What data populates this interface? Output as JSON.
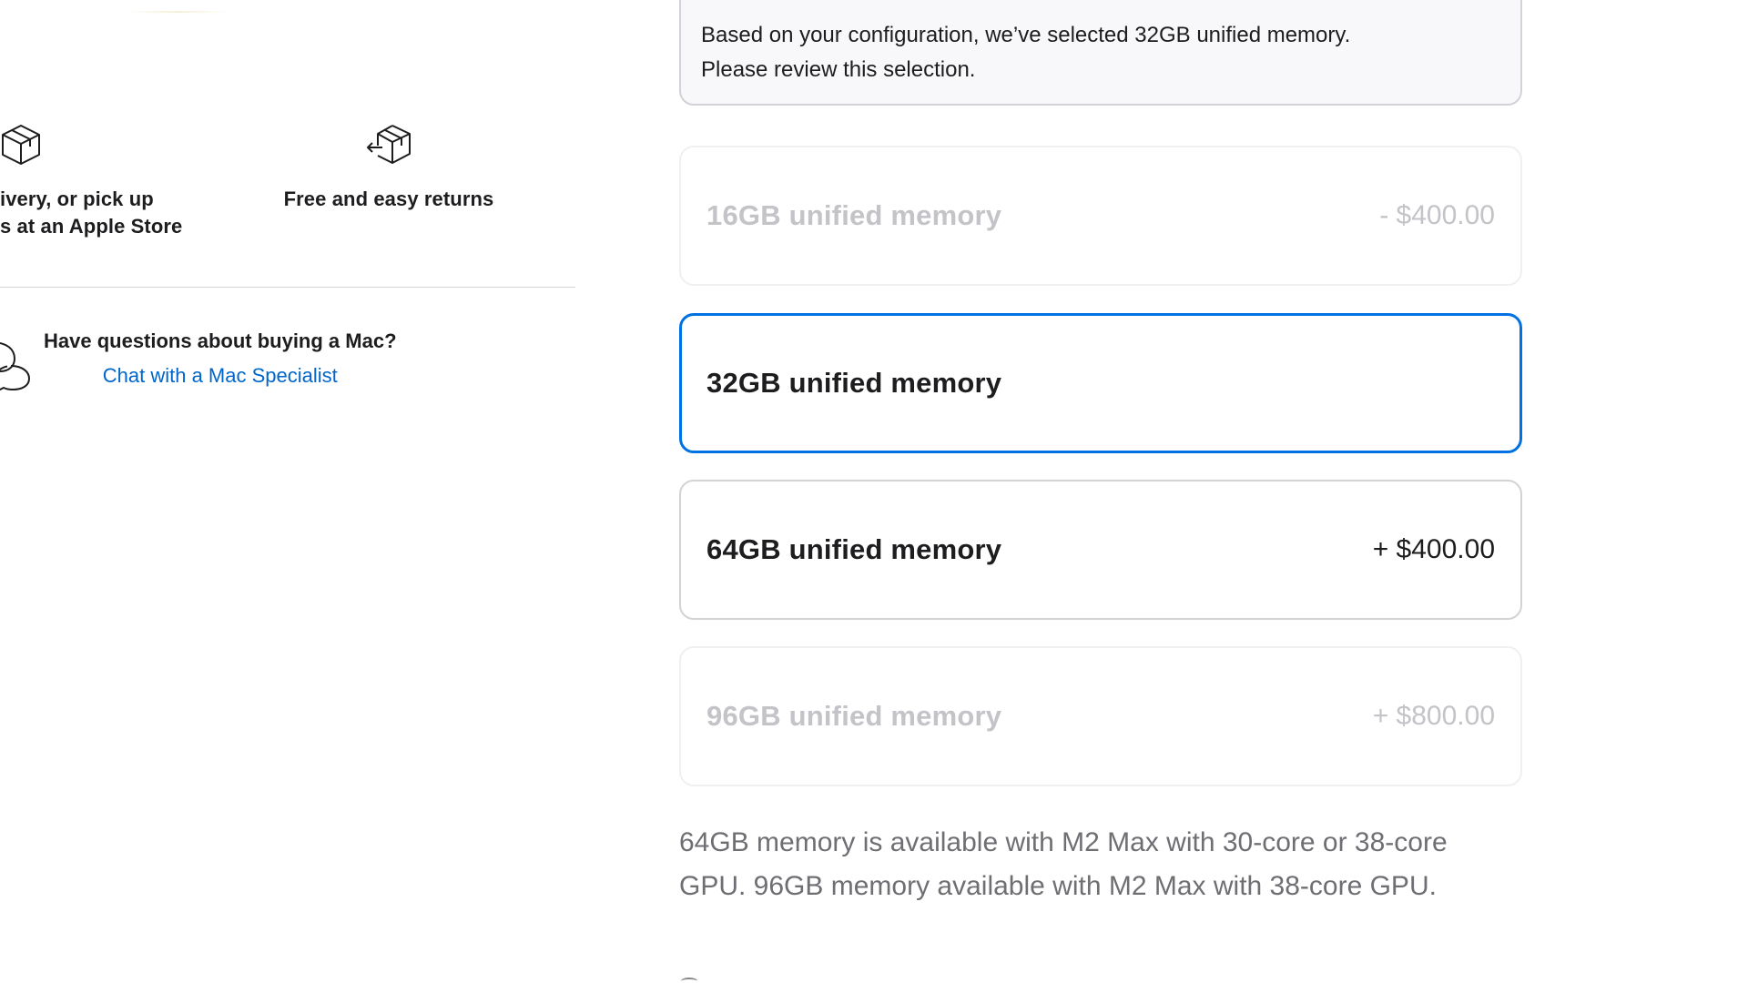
{
  "services": {
    "delivery_text": "ivery, or pick up\ns at an Apple Store",
    "delivery_icon": "box-icon",
    "returns_text": "Free and easy returns",
    "returns_icon": "box-return-icon"
  },
  "help": {
    "question": "Have questions about buying a Mac?",
    "link_label": "Chat with a Mac Specialist",
    "icon": "chat-bubbles-icon"
  },
  "memory": {
    "notice_line1": "Based on your configuration, we’ve selected 32GB unified memory.",
    "notice_line2": "Please review this selection.",
    "options": [
      {
        "label": "16GB unified memory",
        "price": "- $400.00",
        "state": "disabled"
      },
      {
        "label": "32GB unified memory",
        "price": "",
        "state": "selected"
      },
      {
        "label": "64GB unified memory",
        "price": "+ $400.00",
        "state": "available"
      },
      {
        "label": "96GB unified memory",
        "price": "+ $800.00",
        "state": "disabled"
      }
    ],
    "footnote": "64GB memory is available with M2 Max with 30-core or 38-core GPU. 96GB memory available with M2 Max with 38-core GPU."
  },
  "colors": {
    "accent": "#0071e3",
    "link": "#0066cc",
    "text": "#1d1d1f",
    "muted": "#6e6e73",
    "disabled": "#c3c3c8"
  }
}
